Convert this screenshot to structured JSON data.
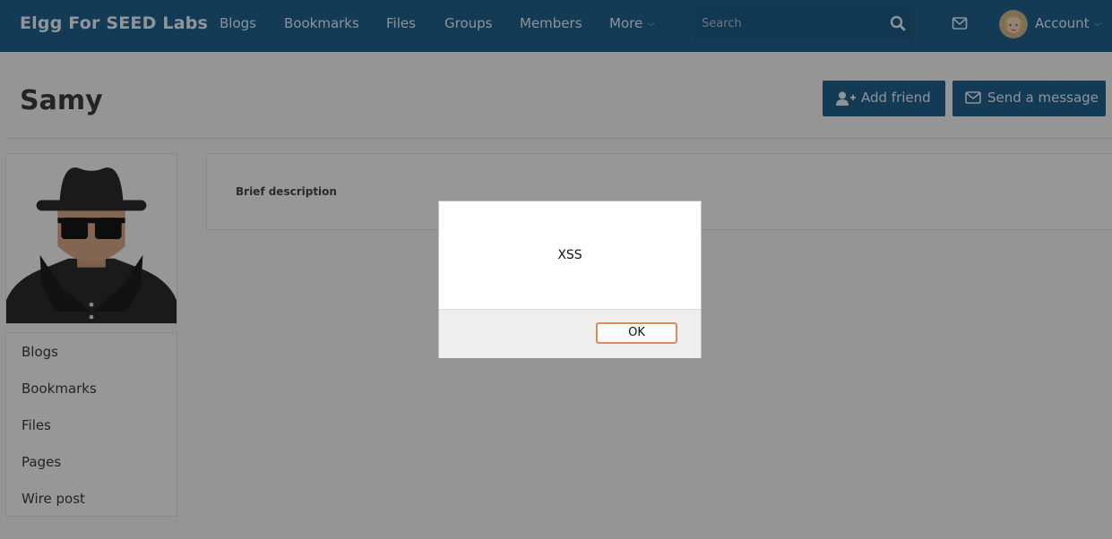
{
  "header": {
    "brand": "Elgg For SEED Labs",
    "nav": [
      "Blogs",
      "Bookmarks",
      "Files",
      "Groups",
      "Members",
      "More"
    ],
    "search_placeholder": "Search",
    "account_label": "Account",
    "icons": [
      "search-icon",
      "mail-icon",
      "chevron-down-icon"
    ]
  },
  "profile": {
    "name": "Samy",
    "add_friend": "Add friend",
    "send_message": "Send a message",
    "brief_description_label": "Brief description"
  },
  "sidebar": {
    "items": [
      "Blogs",
      "Bookmarks",
      "Files",
      "Pages",
      "Wire post"
    ]
  },
  "dialog": {
    "message": "XSS",
    "ok_label": "OK"
  },
  "colors": {
    "topbar": "#1f5f8b",
    "button": "#1f5f8b",
    "ok_border": "#d98c5f"
  }
}
